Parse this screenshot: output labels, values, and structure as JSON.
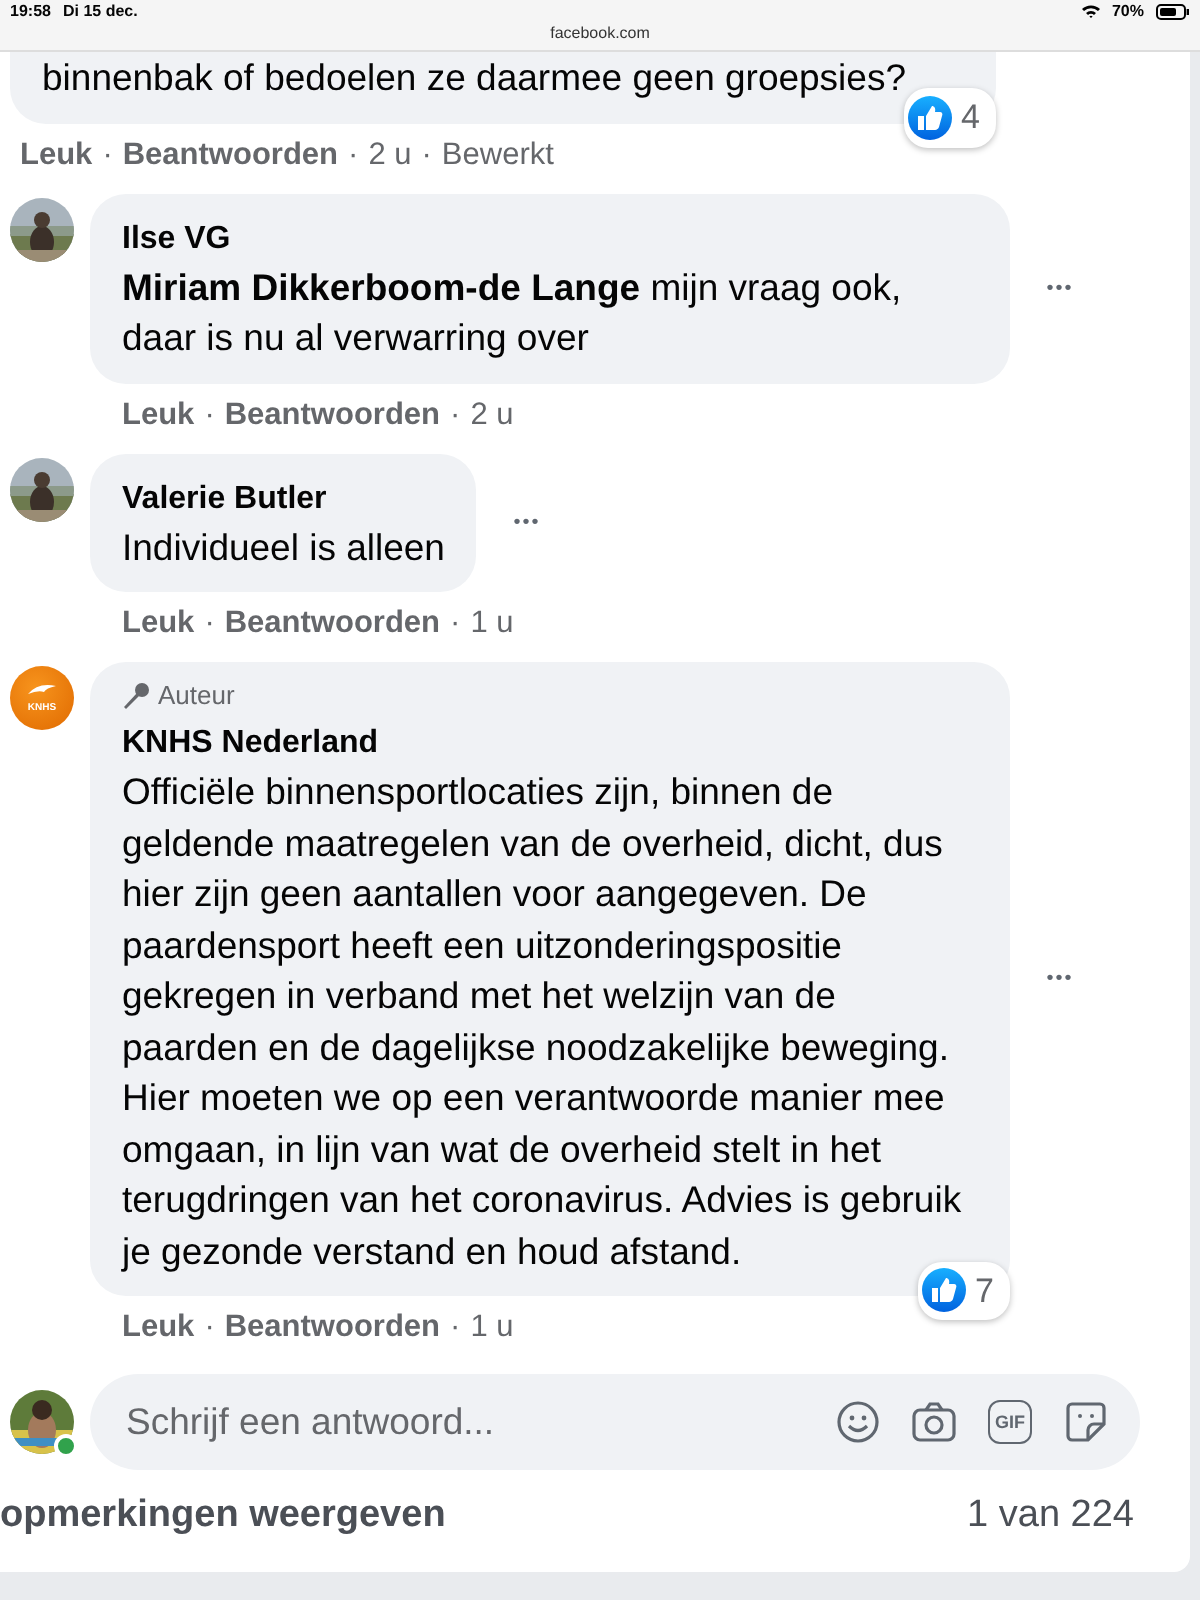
{
  "status_bar": {
    "time": "19:58",
    "date": "Di 15 dec.",
    "battery": "70%"
  },
  "address_bar": {
    "url": "facebook.com"
  },
  "comments": [
    {
      "kind": "partial",
      "text": "binnenbak of bedoelen ze daarmee geen groepsies?",
      "reactions": "4",
      "meta": [
        {
          "kind": "link",
          "text": "Leuk"
        },
        {
          "kind": "sep",
          "text": "·"
        },
        {
          "kind": "link",
          "text": "Beantwoorden"
        },
        {
          "kind": "sep",
          "text": "·"
        },
        {
          "kind": "text",
          "text": "2 u"
        },
        {
          "kind": "sep",
          "text": "·"
        },
        {
          "kind": "text",
          "text": "Bewerkt"
        }
      ]
    },
    {
      "author": "Ilse VG",
      "text": "**Miriam Dikkerboom-de Lange** mijn vraag ook, daar is nu al verwarring over",
      "more": "•••",
      "meta": [
        {
          "kind": "link",
          "text": "Leuk"
        },
        {
          "kind": "sep",
          "text": "·"
        },
        {
          "kind": "link",
          "text": "Beantwoorden"
        },
        {
          "kind": "sep",
          "text": "·"
        },
        {
          "kind": "text",
          "text": "2 u"
        }
      ]
    },
    {
      "author": "Valerie Butler",
      "text": "Individueel is alleen",
      "more": "•••",
      "meta": [
        {
          "kind": "link",
          "text": "Leuk"
        },
        {
          "kind": "sep",
          "text": "·"
        },
        {
          "kind": "link",
          "text": "Beantwoorden"
        },
        {
          "kind": "sep",
          "text": "·"
        },
        {
          "kind": "text",
          "text": "1 u"
        }
      ]
    },
    {
      "kind": "logo",
      "logo_text": "KNHS",
      "badge": "Auteur",
      "author": "KNHS Nederland",
      "text": "Officiële binnensportlocaties zijn, binnen de geldende maatregelen van de overheid, dicht, dus hier zijn geen aantallen voor aangegeven. De paardensport heeft een uitzonderingspositie gekregen in verband met het welzijn van de paarden en de dagelijkse noodzakelijke beweging. Hier moeten we op een verantwoorde manier mee omgaan, in lijn van wat de overheid stelt in het terugdringen van het coronavirus. Advies is gebruik je gezonde verstand en houd afstand.",
      "more": "•••",
      "reactions": "7",
      "meta": [
        {
          "kind": "link",
          "text": "Leuk"
        },
        {
          "kind": "sep",
          "text": "·"
        },
        {
          "kind": "link",
          "text": "Beantwoorden"
        },
        {
          "kind": "sep",
          "text": "·"
        },
        {
          "kind": "text",
          "text": "1 u"
        }
      ]
    }
  ],
  "reply_box": {
    "placeholder": "Schrijf een antwoord...",
    "online": true,
    "gif_label": "GIF"
  },
  "footer": {
    "more_comments": "opmerkingen weergeven",
    "count": "1 van 224"
  }
}
